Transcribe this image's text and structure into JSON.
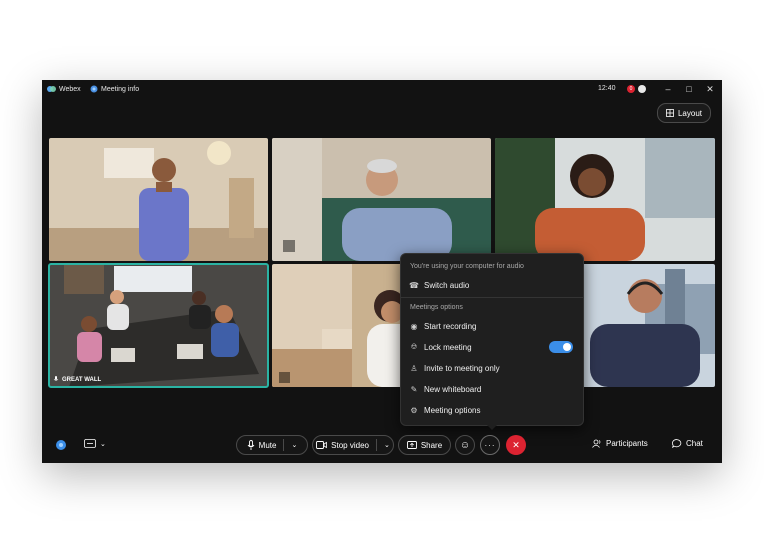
{
  "titlebar": {
    "app_name": "Webex",
    "meeting_info": "Meeting info",
    "time": "12:40",
    "notification_count": "0"
  },
  "layout_label": "Layout",
  "tiles": [
    {
      "name": "participant-woman-standing"
    },
    {
      "name": "participant-man-glasses"
    },
    {
      "name": "participant-woman-smiling"
    },
    {
      "name": "participant-conference-room",
      "label": "GREAT WALL"
    },
    {
      "name": "participant-woman-speaking"
    },
    {
      "name": "participant-man-headphones"
    }
  ],
  "menu": {
    "audio_heading": "You're using your computer for audio",
    "switch_audio": "Switch audio",
    "options_heading": "Meetings options",
    "items": [
      {
        "label": "Start recording",
        "icon": "record-icon"
      },
      {
        "label": "Lock meeting",
        "icon": "lock-icon",
        "toggle_on": true
      },
      {
        "label": "Invite to meeting only",
        "icon": "invite-icon"
      },
      {
        "label": "New whiteboard",
        "icon": "whiteboard-icon"
      },
      {
        "label": "Meeting options",
        "icon": "gear-icon"
      }
    ]
  },
  "controls": {
    "mute": "Mute",
    "stop_video": "Stop video",
    "share": "Share",
    "participants": "Participants",
    "chat": "Chat"
  },
  "colors": {
    "accent": "#3b8ee8",
    "end_call": "#dc2331",
    "active_speaker": "#2bb3a3"
  }
}
